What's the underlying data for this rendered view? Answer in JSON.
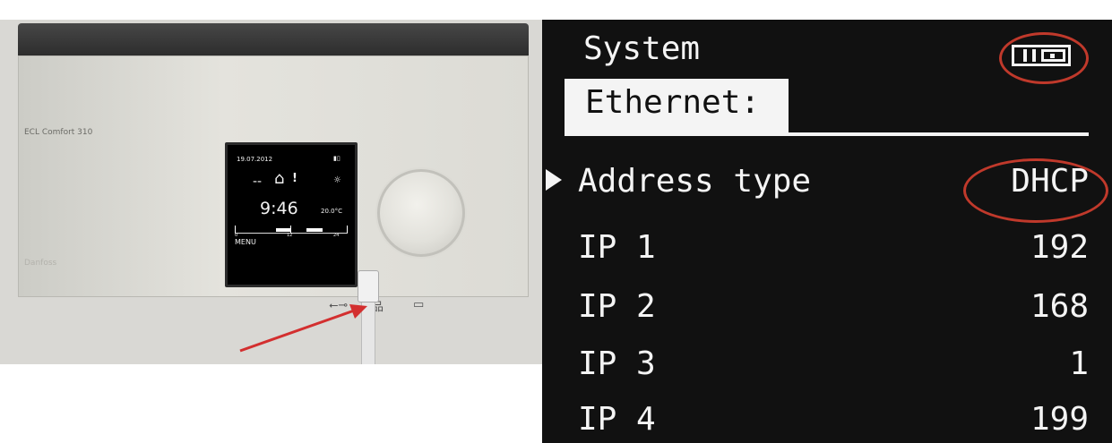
{
  "device": {
    "brand_label": "ECL Comfort 310",
    "logo_text": "Danfoss",
    "lcd": {
      "date": "19.07.2012",
      "battery_icon": "battery-icon",
      "dash": "--",
      "house_icon": "house-icon",
      "alert": "!",
      "sun_icon": "sun-icon",
      "time": "9:46",
      "temperature": "20.0°C",
      "menu_label": "MENU",
      "tick_0": "0",
      "tick_12": "12",
      "tick_24": "24"
    },
    "ports": {
      "usb_icon": "usb-icon",
      "ethernet_icon": "ethernet-icon",
      "power_icon": "power-connector-icon"
    }
  },
  "screen": {
    "title": "System",
    "mode_icon": "display-mode-icon",
    "section": "Ethernet:",
    "rows": [
      {
        "label": "Address type",
        "value": "DHCP"
      },
      {
        "label": "IP 1",
        "value": "192"
      },
      {
        "label": "IP 2",
        "value": "168"
      },
      {
        "label": "IP 3",
        "value": "1"
      },
      {
        "label": "IP 4",
        "value": "199"
      }
    ]
  },
  "colors": {
    "highlight_ring": "#c0392b",
    "arrow": "#d32f2f",
    "screen_bg": "#111111",
    "screen_fg": "#f4f4f4"
  }
}
